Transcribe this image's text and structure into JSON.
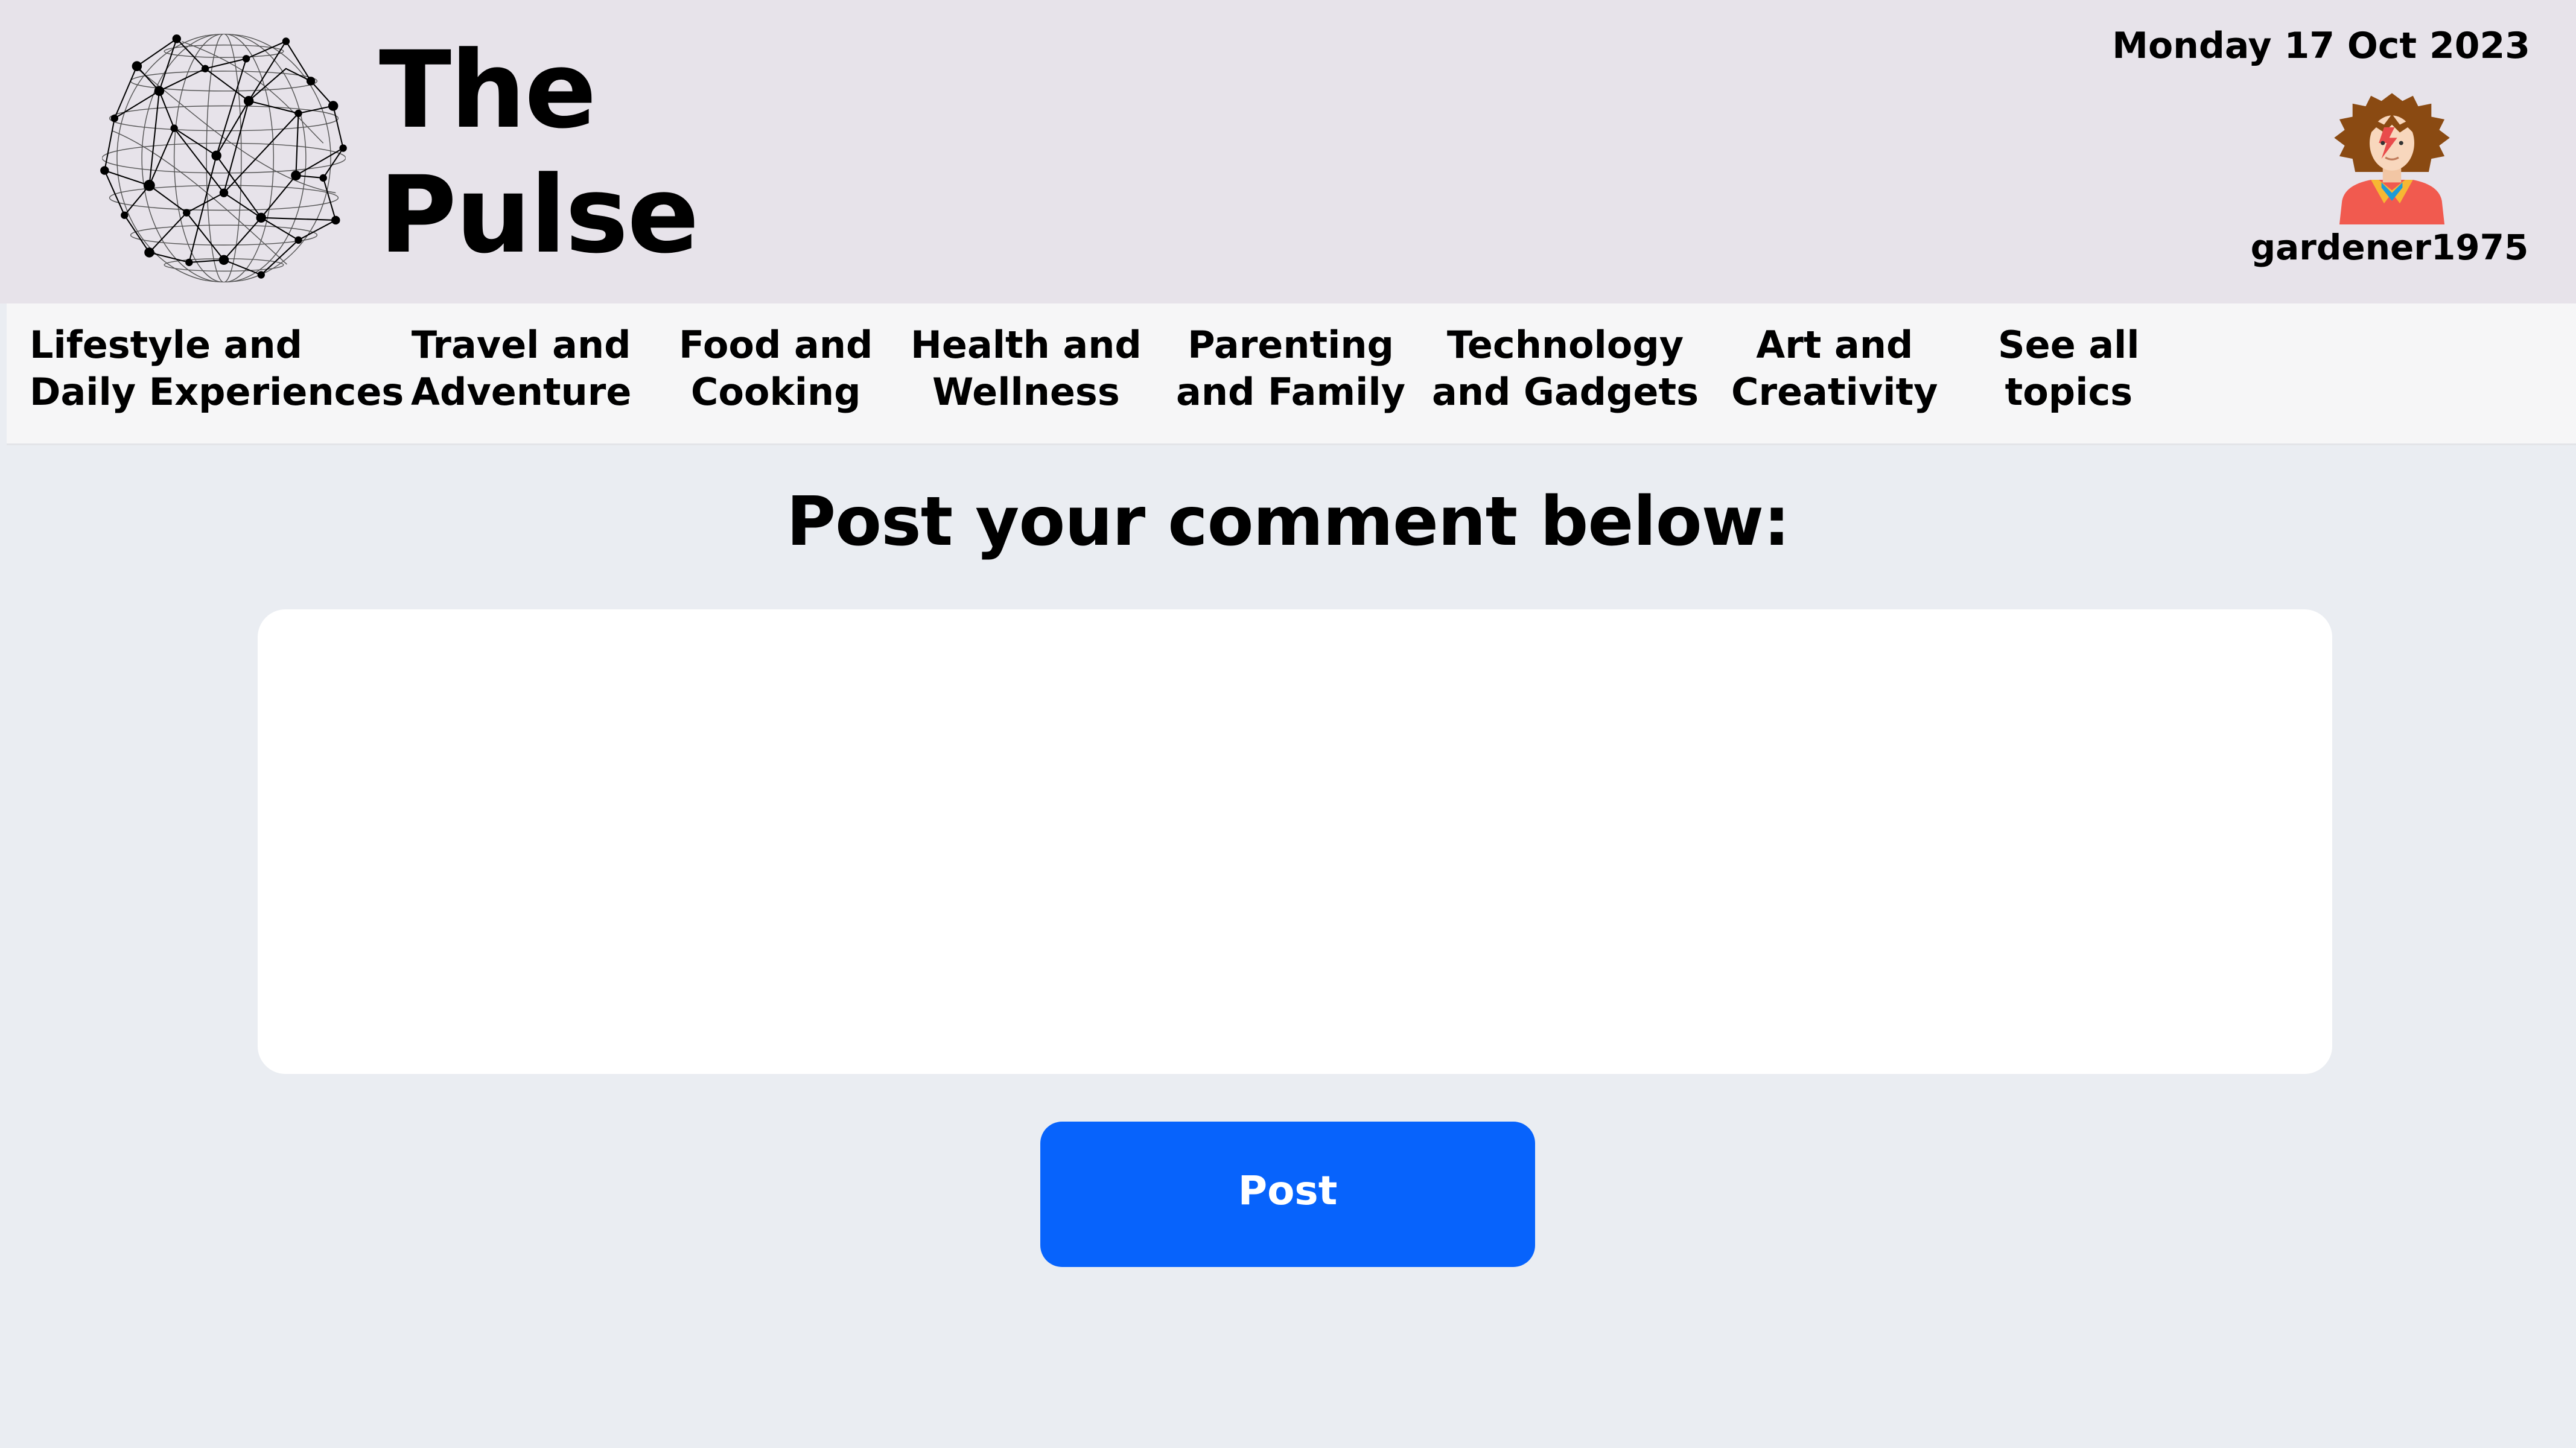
{
  "header": {
    "brand_title": "The\nPulse",
    "date": "Monday 17 Oct 2023",
    "username": "gardener1975",
    "logo_icon": "globe-network-icon",
    "avatar_icon": "punk-rocker-avatar"
  },
  "topics": [
    {
      "label": "Lifestyle and\nDaily Experiences"
    },
    {
      "label": "Travel and\nAdventure"
    },
    {
      "label": "Food and\nCooking"
    },
    {
      "label": "Health and\nWellness"
    },
    {
      "label": "Parenting\nand Family"
    },
    {
      "label": "Technology\nand Gadgets"
    },
    {
      "label": "Art and\nCreativity"
    },
    {
      "label": "See all\ntopics"
    }
  ],
  "main": {
    "heading": "Post your comment below:",
    "comment_value": "",
    "comment_placeholder": "",
    "post_label": "Post"
  },
  "colors": {
    "header_bg": "#e7e3ea",
    "nav_bg": "#f6f6f7",
    "page_bg": "#eaedf2",
    "button_bg": "#0763fc",
    "button_text": "#ffffff"
  }
}
